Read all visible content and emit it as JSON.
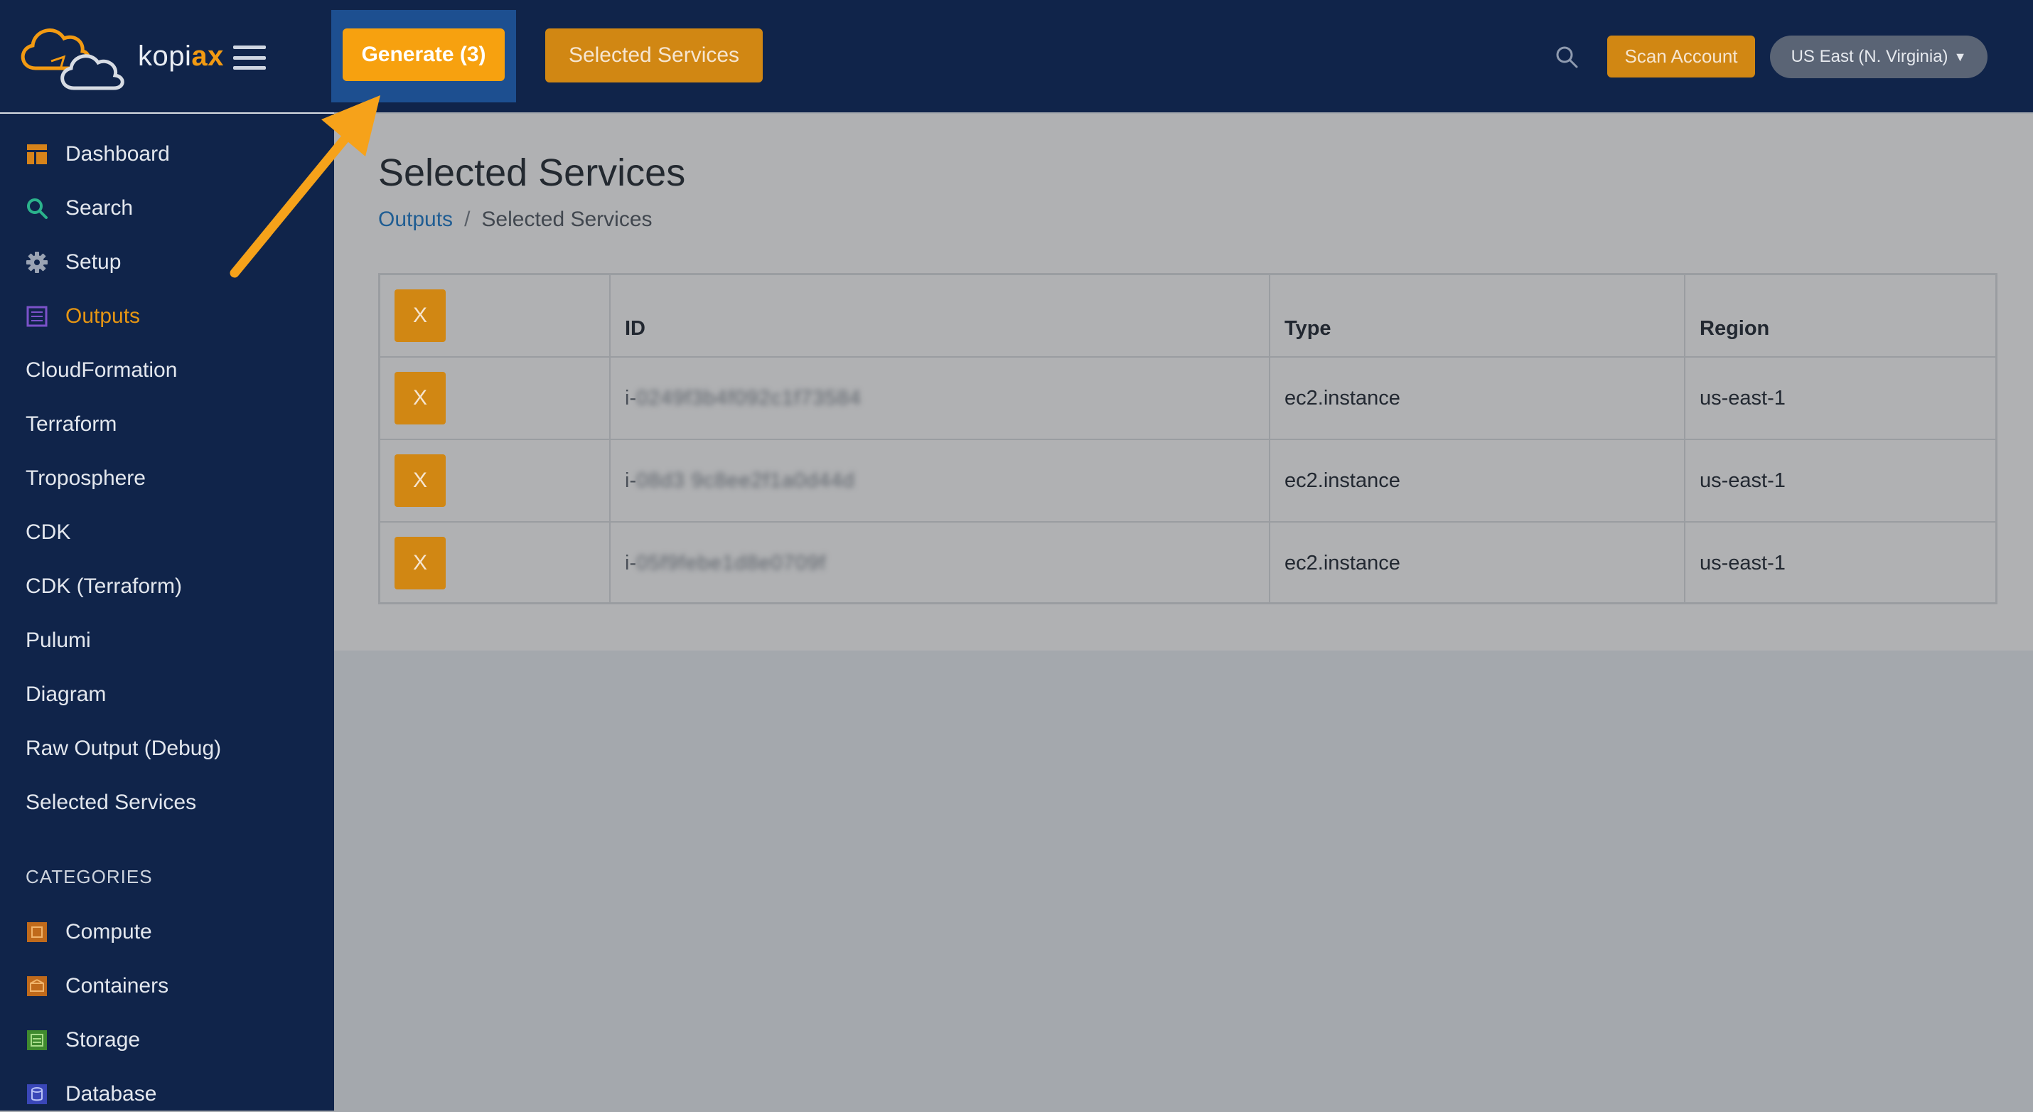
{
  "app": {
    "logo_text_main": "kopi",
    "logo_text_accent": "ax"
  },
  "topbar": {
    "generate_label": "Generate (3)",
    "selected_services_label": "Selected Services",
    "scan_account_label": "Scan Account",
    "region_label": "US East (N. Virginia)"
  },
  "sidebar": {
    "items": [
      {
        "label": "Dashboard",
        "icon": "dashboard-icon"
      },
      {
        "label": "Search",
        "icon": "search-icon"
      },
      {
        "label": "Setup",
        "icon": "gear-icon"
      },
      {
        "label": "Outputs",
        "icon": "outputs-list-icon",
        "active": true
      },
      {
        "label": "CloudFormation"
      },
      {
        "label": "Terraform"
      },
      {
        "label": "Troposphere"
      },
      {
        "label": "CDK"
      },
      {
        "label": "CDK (Terraform)"
      },
      {
        "label": "Pulumi"
      },
      {
        "label": "Diagram"
      },
      {
        "label": "Raw Output (Debug)"
      },
      {
        "label": "Selected Services"
      }
    ],
    "categories_heading": "CATEGORIES",
    "categories": [
      {
        "label": "Compute",
        "icon": "compute-icon"
      },
      {
        "label": "Containers",
        "icon": "containers-icon"
      },
      {
        "label": "Storage",
        "icon": "storage-icon"
      },
      {
        "label": "Database",
        "icon": "database-icon"
      }
    ]
  },
  "main": {
    "title": "Selected Services",
    "breadcrumb": {
      "parent": "Outputs",
      "separator": "/",
      "current": "Selected Services"
    },
    "table": {
      "remove_all_label": "X",
      "columns": [
        "ID",
        "Type",
        "Region"
      ],
      "rows": [
        {
          "remove_label": "X",
          "id_prefix": "i-",
          "id_blurred": "0249f3b4f092c1f73584",
          "type": "ec2.instance",
          "region": "us-east-1"
        },
        {
          "remove_label": "X",
          "id_prefix": "i-",
          "id_blurred": "08d3 9c8ee2f1a0d44d",
          "type": "ec2.instance",
          "region": "us-east-1"
        },
        {
          "remove_label": "X",
          "id_prefix": "i-",
          "id_blurred": "05f9febe1d8e0709f",
          "type": "ec2.instance",
          "region": "us-east-1"
        }
      ]
    }
  },
  "colors": {
    "topbar_bg": "#10244a",
    "accent_orange": "#f7a10f",
    "muted_orange": "#d18713",
    "link_blue": "#1f5d93",
    "arrow": "#f6a21a"
  }
}
